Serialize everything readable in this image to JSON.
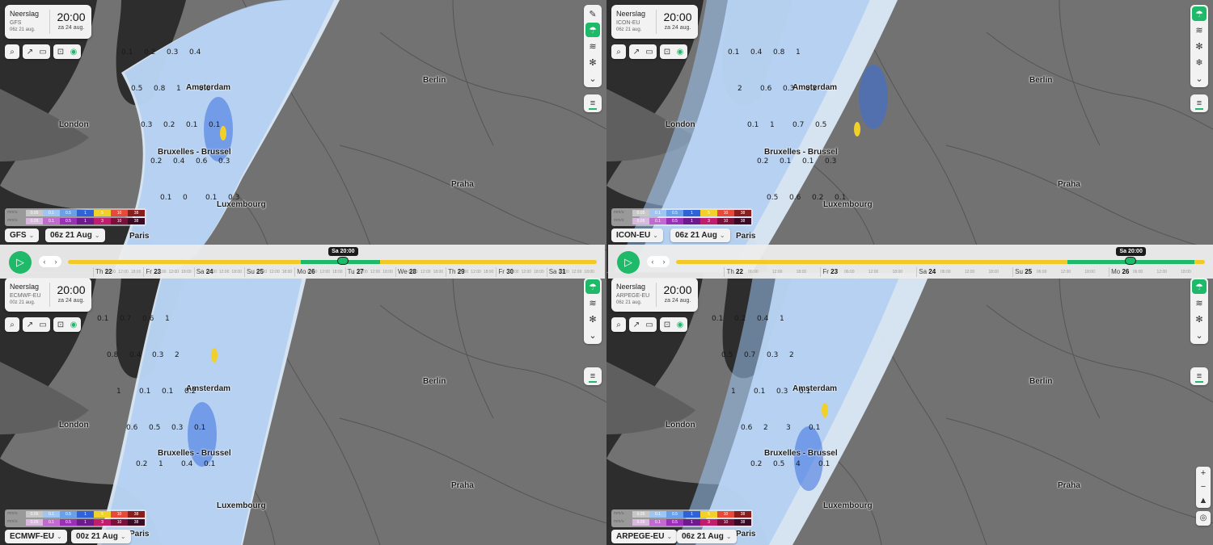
{
  "colors": {
    "accent": "#1fb96a",
    "slider": "#f3c92a",
    "land": "#727272",
    "sea": "#2d2d2d"
  },
  "icons": [
    "search-icon",
    "share-icon",
    "video-icon",
    "export-icon",
    "screenshot-icon",
    "rain-layer-icon",
    "wind-layer-icon",
    "snow-icon",
    "chevron-down-icon",
    "layers-icon",
    "play-icon",
    "zoom-in-icon",
    "zoom-out-icon",
    "compass-icon",
    "locate-icon"
  ],
  "cities": [
    "Amsterdam",
    "Berlin",
    "London",
    "Bruxelles - Brussel",
    "Praha",
    "Luxembourg",
    "Paris"
  ],
  "legend": {
    "unit": "mm/u",
    "row1": [
      "0.05",
      "0.1",
      "0.5",
      "1",
      "5",
      "10",
      "38"
    ],
    "row2": [
      "0.05",
      "0.1",
      "0.5",
      "1",
      "3",
      "10",
      "38"
    ]
  },
  "panels": [
    {
      "label": "Neerslag",
      "model_line": "GFS",
      "run_line": "06z 21 aug.",
      "time": "20:00",
      "date": "za 24 aug.",
      "model_dropdown": "GFS",
      "run_dropdown": "06z 21 Aug",
      "values": [
        "0.1",
        "0.2",
        "0.3",
        "0.4",
        "0.5",
        "0.8",
        "1",
        "0.6",
        "0.3",
        "0.2",
        "0.1",
        "0.1",
        "0.2",
        "0.4",
        "0.6",
        "0.3",
        "0.1",
        "0",
        "0.1",
        "0.3"
      ]
    },
    {
      "label": "Neerslag",
      "model_line": "ICON-EU",
      "run_line": "06z 21 aug.",
      "time": "20:00",
      "date": "za 24 aug.",
      "model_dropdown": "ICON-EU",
      "run_dropdown": "06z 21 Aug",
      "values": [
        "0.1",
        "0.4",
        "0.8",
        "1",
        "2",
        "0.6",
        "0.3",
        "0.2",
        "0.1",
        "1",
        "0.7",
        "0.5",
        "0.2",
        "0.1",
        "0.1",
        "0.3",
        "0.5",
        "0.6",
        "0.2",
        "0.1"
      ]
    },
    {
      "label": "Neerslag",
      "model_line": "ECMWF-EU",
      "run_line": "00z 21 aug.",
      "time": "20:00",
      "date": "za 24 aug.",
      "model_dropdown": "ECMWF-EU",
      "run_dropdown": "00z 21 Aug",
      "values": [
        "0.1",
        "0.7",
        "0.6",
        "1",
        "0.8",
        "0.4",
        "0.3",
        "2",
        "1",
        "0.1",
        "0.1",
        "0.2",
        "0.6",
        "0.5",
        "0.3",
        "0.1",
        "0.2",
        "1",
        "0.4",
        "0.1"
      ]
    },
    {
      "label": "Neerslag",
      "model_line": "ARPEGE-EU",
      "run_line": "06z 21 aug.",
      "time": "20:00",
      "date": "za 24 aug.",
      "model_dropdown": "ARPEGE-EU",
      "run_dropdown": "06z 21 Aug",
      "values": [
        "0.1",
        "0.2",
        "0.4",
        "1",
        "0.5",
        "0.7",
        "0.3",
        "2",
        "1",
        "0.1",
        "0.3",
        "0.1",
        "0.6",
        "2",
        "3",
        "0.1",
        "0.2",
        "0.5",
        "4",
        "0.1"
      ]
    }
  ],
  "timelines": [
    {
      "tooltip": "Sa 20:00",
      "selection": [
        0.44,
        0.59
      ],
      "knob": 0.52,
      "days": [
        {
          "name": "Th",
          "num": "22"
        },
        {
          "name": "Fr",
          "num": "23"
        },
        {
          "name": "Sa",
          "num": "24"
        },
        {
          "name": "Su",
          "num": "25"
        },
        {
          "name": "Mo",
          "num": "26"
        },
        {
          "name": "Tu",
          "num": "27"
        },
        {
          "name": "We",
          "num": "28"
        },
        {
          "name": "Th",
          "num": "29"
        },
        {
          "name": "Fr",
          "num": "30"
        },
        {
          "name": "Sa",
          "num": "31"
        }
      ],
      "hours": [
        "06:00",
        "12:00",
        "18:00"
      ]
    },
    {
      "tooltip": "Sa 20:00",
      "selection": [
        0.74,
        0.98
      ],
      "knob": 0.86,
      "days": [
        {
          "name": "Th",
          "num": "22"
        },
        {
          "name": "Fr",
          "num": "23"
        },
        {
          "name": "Sa",
          "num": "24"
        },
        {
          "name": "Su",
          "num": "25"
        },
        {
          "name": "Mo",
          "num": "26"
        }
      ],
      "hours": [
        "06:00",
        "12:00",
        "18:00"
      ]
    }
  ]
}
